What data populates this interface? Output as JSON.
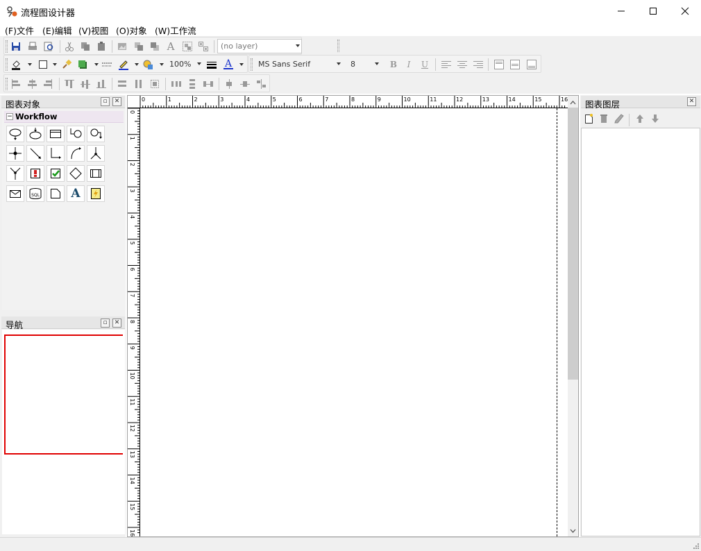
{
  "app": {
    "title": "流程图设计器"
  },
  "menu": [
    {
      "label": "(F)文件"
    },
    {
      "label": "(E)编辑"
    },
    {
      "label": "(V)视图"
    },
    {
      "label": "(O)对象"
    },
    {
      "label": "(W)工作流"
    }
  ],
  "toolbar": {
    "row1": {
      "icons": [
        "save-icon",
        "print-icon",
        "print-preview-icon",
        "cut-icon",
        "copy-icon",
        "paste-icon",
        "image-icon",
        "bring-front-icon",
        "send-back-icon",
        "text-icon",
        "group-icon",
        "ungroup-icon"
      ],
      "layer_combo": "(no layer)"
    },
    "row2": {
      "icons": [
        "fill-color-icon",
        "rectangle-icon",
        "format-painter-icon",
        "shadow-icon",
        "line-style-icon",
        "line-color-icon",
        "shape-color-icon"
      ],
      "zoom": "100%",
      "font_name": "MS Sans Serif",
      "font_size": "8",
      "bold": "B",
      "italic": "I",
      "underline": "U",
      "align": [
        "align-left-icon",
        "align-center-icon",
        "align-right-icon"
      ],
      "valign": [
        "align-top-icon",
        "align-middle-icon",
        "align-bottom-icon"
      ]
    },
    "row3": {
      "icons": [
        "align-lefts-icon",
        "align-centers-icon",
        "align-rights-icon",
        "align-tops-icon",
        "align-middles-icon",
        "align-bottoms-icon",
        "same-width-icon",
        "same-height-icon",
        "same-size-icon",
        "space-across-icon",
        "space-down-icon",
        "center-horizontally-icon",
        "center-vertically-icon",
        "make-same-space-icon",
        "distribute-icon"
      ]
    }
  },
  "left_panel": {
    "objects_title": "图表对象",
    "workflow_group": "Workflow",
    "shapes": [
      "start-shape-icon",
      "end-shape-icon",
      "activity-shape-icon",
      "connector-loop-icon",
      "loop-shape-icon",
      "junction-icon",
      "straight-line-icon",
      "orthogonal-line-icon",
      "curve-line-icon",
      "split-icon",
      "merge-icon",
      "manual-task-icon",
      "check-task-icon",
      "decision-icon",
      "subprocess-icon",
      "message-icon",
      "database-sql-icon",
      "document-icon",
      "text-tool-icon",
      "script-icon"
    ],
    "text_tool_label": "A",
    "sql_label": "SQL",
    "nav_title": "导航"
  },
  "ruler": {
    "top": [
      "0",
      "1",
      "2",
      "3",
      "4",
      "5",
      "6",
      "7",
      "8",
      "9",
      "10",
      "11",
      "12",
      "13",
      "14",
      "15",
      "16"
    ],
    "left": [
      "0",
      "1",
      "2",
      "3",
      "4",
      "5",
      "6",
      "7",
      "8",
      "9",
      "10",
      "11",
      "12",
      "13",
      "14",
      "15",
      "16"
    ]
  },
  "right_panel": {
    "layers_title": "图表图层",
    "icons": [
      "new-layer-icon",
      "delete-layer-icon",
      "edit-layer-icon",
      "move-layer-up-icon",
      "move-layer-down-icon"
    ]
  },
  "colors": {
    "nav_rect": "#e00000",
    "font_color_bar": "#1a33cc",
    "line_color_bar": "#1a33cc"
  }
}
